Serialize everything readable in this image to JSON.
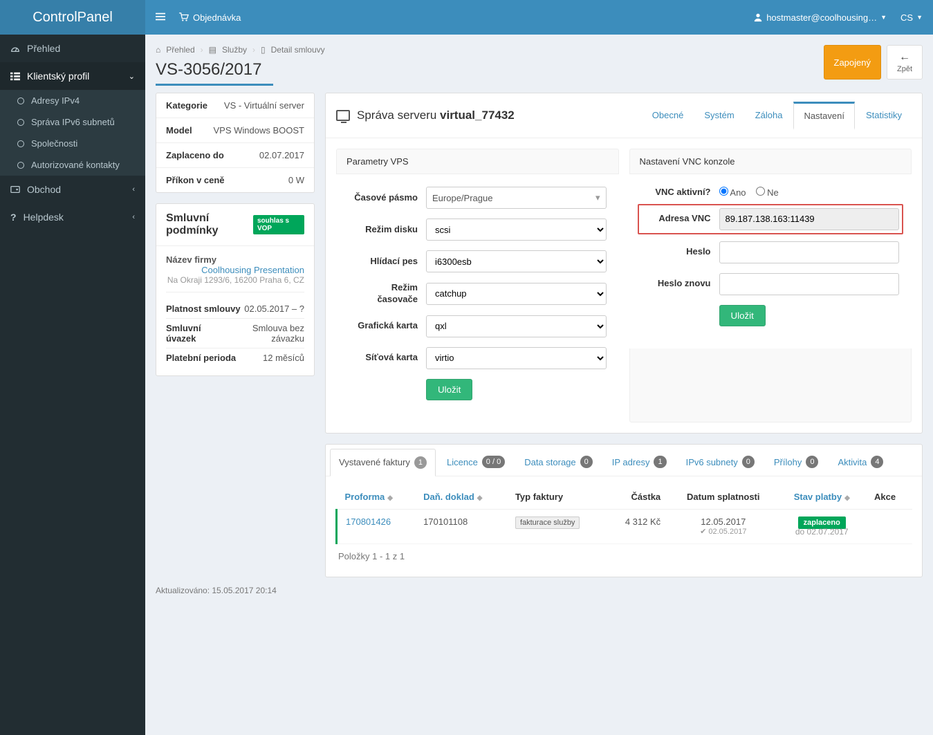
{
  "logo": "ControlPanel",
  "topbar": {
    "order": "Objednávka",
    "user": "hostmaster@coolhousing…",
    "lang": "CS"
  },
  "sidebar": {
    "overview": "Přehled",
    "client_profile": "Klientský profil",
    "sub": {
      "ipv4": "Adresy IPv4",
      "ipv6": "Správa IPv6 subnetů",
      "companies": "Společnosti",
      "contacts": "Autorizované kontakty"
    },
    "shop": "Obchod",
    "helpdesk": "Helpdesk"
  },
  "breadcrumb": {
    "a": "Přehled",
    "b": "Služby",
    "c": "Detail smlouvy"
  },
  "page_title": "VS-3056/2017",
  "buttons": {
    "connected": "Zapojený",
    "back": "Zpět"
  },
  "info": {
    "category_k": "Kategorie",
    "category_v": "VS - Virtuální server",
    "model_k": "Model",
    "model_v": "VPS Windows BOOST",
    "paid_k": "Zaplaceno do",
    "paid_v": "02.07.2017",
    "power_k": "Příkon v ceně",
    "power_v": "0 W"
  },
  "contract": {
    "title": "Smluvní podmínky",
    "badge": "souhlas s VOP",
    "company_name_k": "Název firmy",
    "company_name_v": "Coolhousing Presentation",
    "address": "Na Okraji 1293/6, 16200 Praha 6, CZ",
    "validity_k": "Platnost smlouvy",
    "validity_v": "02.05.2017 – ?",
    "term_k": "Smluvní úvazek",
    "term_v": "Smlouva bez závazku",
    "period_k": "Platební perioda",
    "period_v": "12 měsíců"
  },
  "server": {
    "title_prefix": "Správa serveru",
    "title_name": "virtual_77432",
    "tabs": {
      "general": "Obecné",
      "system": "Systém",
      "backup": "Záloha",
      "settings": "Nastavení",
      "stats": "Statistiky"
    }
  },
  "params": {
    "header": "Parametry VPS",
    "tz_label": "Časové pásmo",
    "tz_value": "Europe/Prague",
    "disk_label": "Režim disku",
    "disk_value": "scsi",
    "watchdog_label": "Hlídací pes",
    "watchdog_value": "i6300esb",
    "timer_label": "Režim časovače",
    "timer_value": "catchup",
    "gpu_label": "Grafická karta",
    "gpu_value": "qxl",
    "nic_label": "Síťová karta",
    "nic_value": "virtio",
    "save": "Uložit"
  },
  "vnc": {
    "header": "Nastavení VNC konzole",
    "active_label": "VNC aktivní?",
    "yes": "Ano",
    "no": "Ne",
    "addr_label": "Adresa VNC",
    "addr_value": "89.187.138.163:11439",
    "pass_label": "Heslo",
    "pass2_label": "Heslo znovu",
    "save": "Uložit"
  },
  "btabs": {
    "invoices": "Vystavené faktury",
    "invoices_n": "1",
    "licenses": "Licence",
    "licenses_n": "0 / 0",
    "storage": "Data storage",
    "storage_n": "0",
    "ip": "IP adresy",
    "ip_n": "1",
    "ipv6": "IPv6 subnety",
    "ipv6_n": "0",
    "attach": "Přílohy",
    "attach_n": "0",
    "activity": "Aktivita",
    "activity_n": "4"
  },
  "table": {
    "h_proforma": "Proforma",
    "h_tax": "Daň. doklad",
    "h_type": "Typ faktury",
    "h_amount": "Částka",
    "h_due": "Datum splatnosti",
    "h_status": "Stav platby",
    "h_action": "Akce",
    "r": {
      "proforma": "170801426",
      "tax": "170101108",
      "type": "fakturace služby",
      "amount": "4 312 Kč",
      "due": "12.05.2017",
      "due_sub": "02.05.2017",
      "status": "zaplaceno",
      "status_sub": "do 02.07.2017"
    },
    "footer": "Položky 1 - 1 z 1"
  },
  "page_footer": "Aktualizováno: 15.05.2017 20:14"
}
